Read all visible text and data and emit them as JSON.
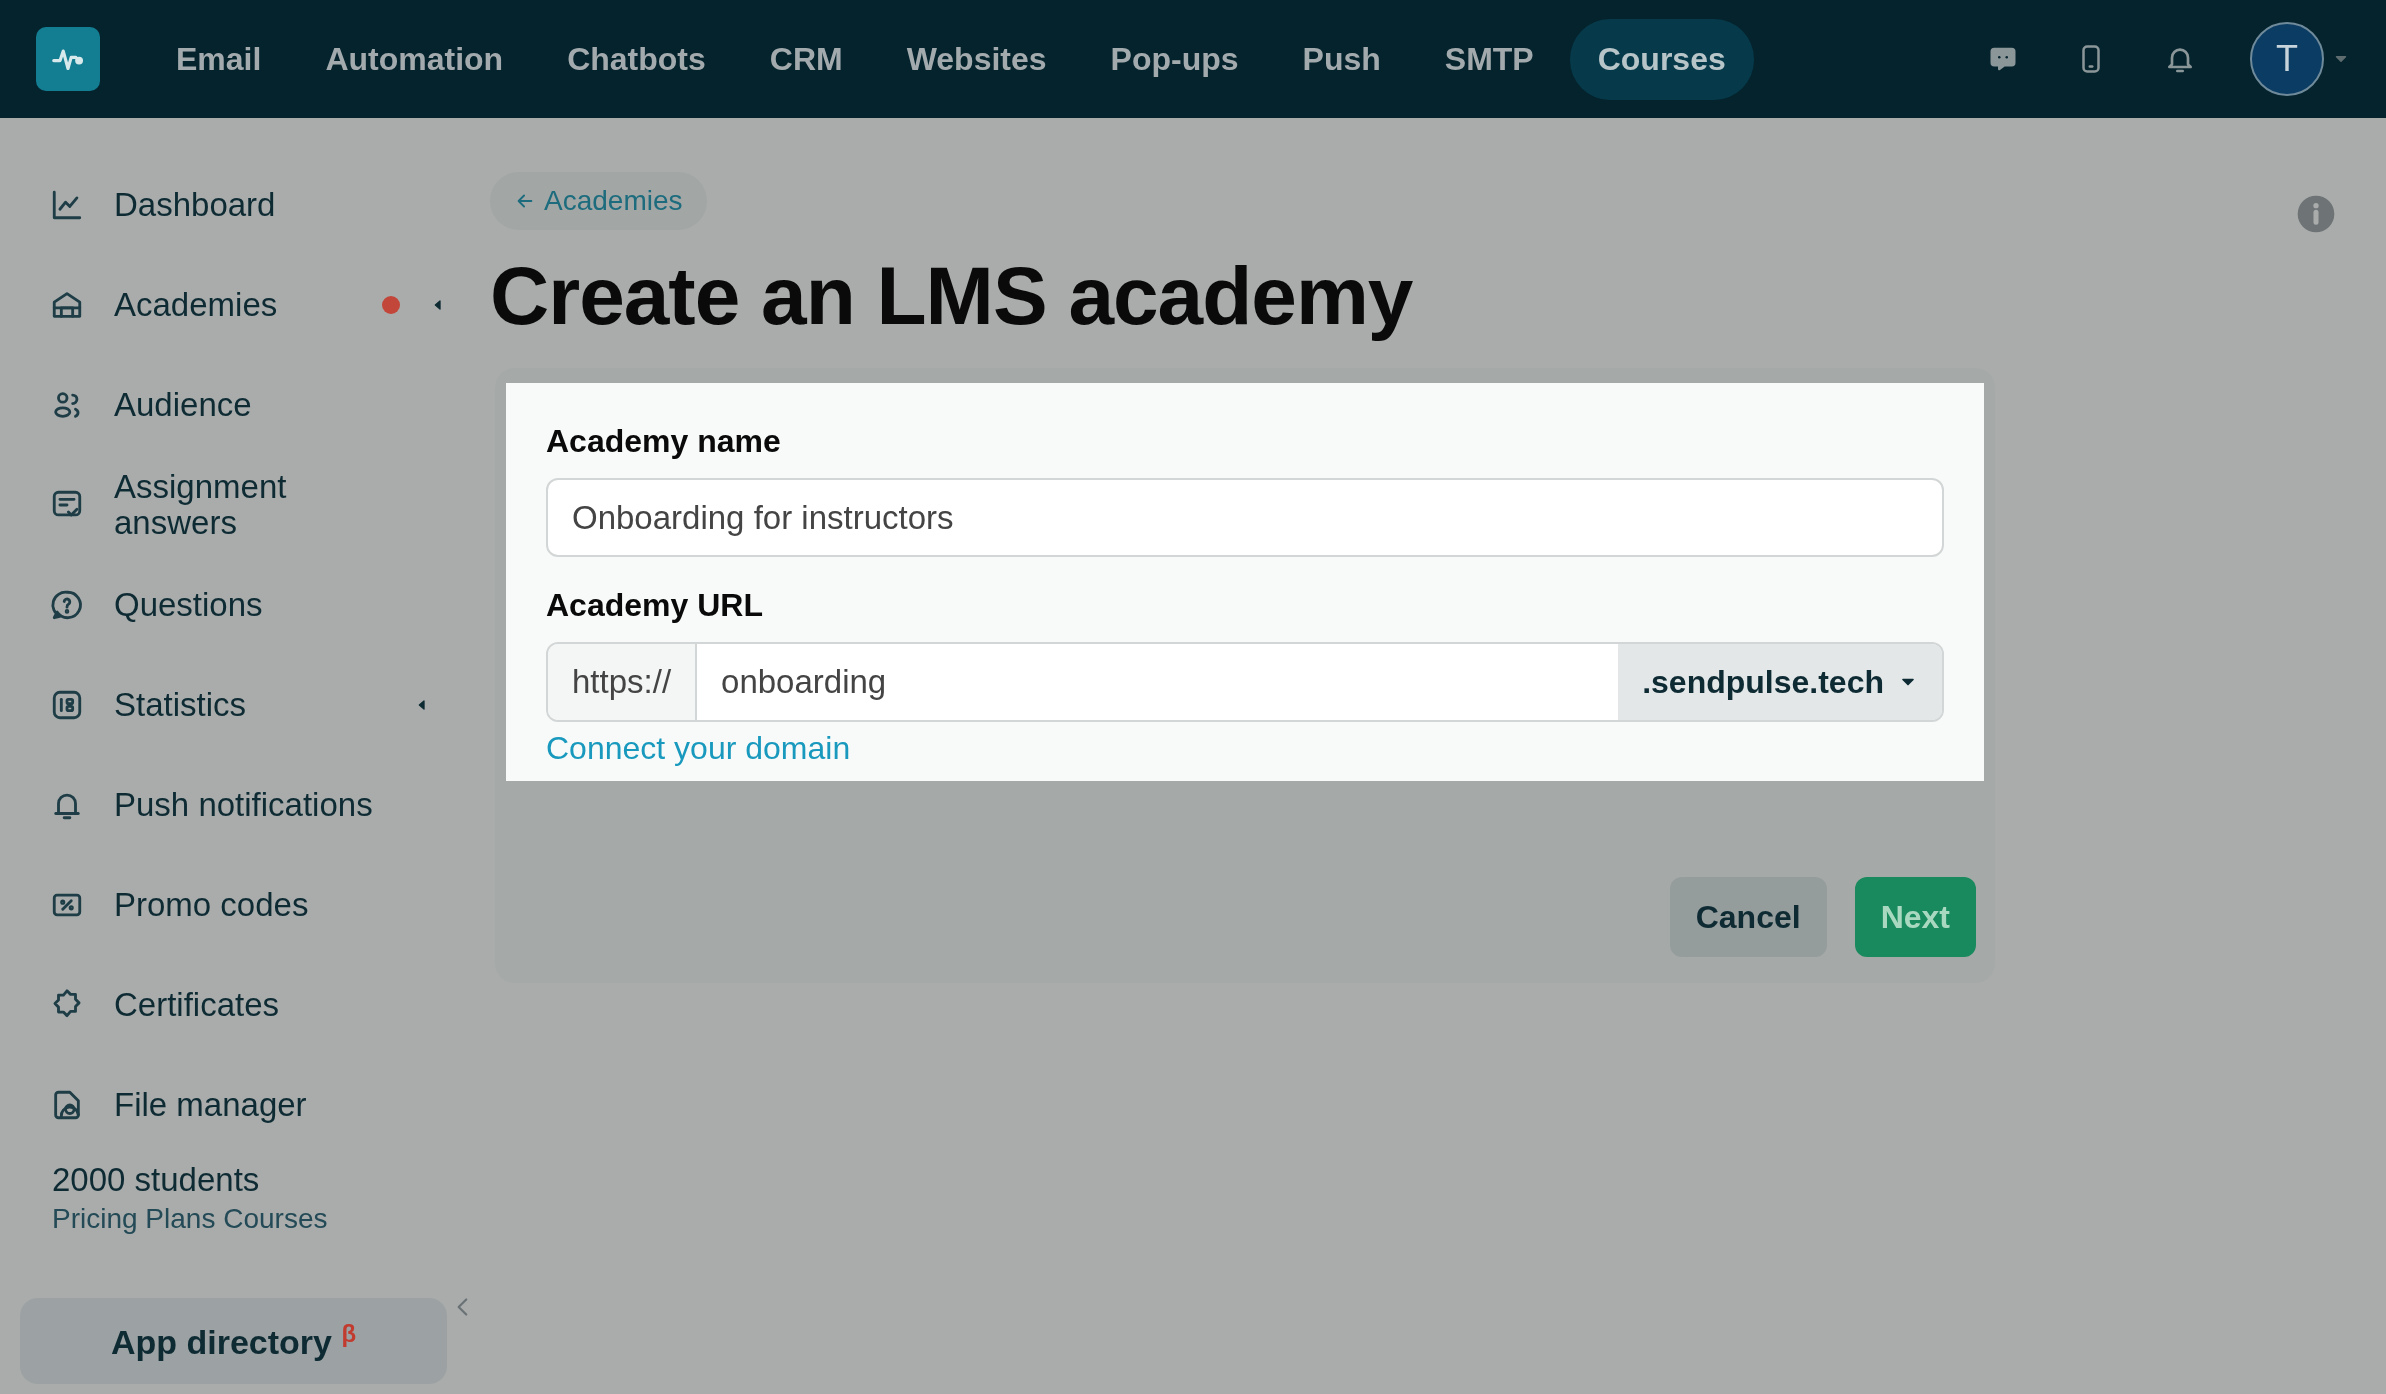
{
  "top_nav": {
    "items": [
      {
        "label": "Email",
        "selected": false
      },
      {
        "label": "Automation",
        "selected": false
      },
      {
        "label": "Chatbots",
        "selected": false
      },
      {
        "label": "CRM",
        "selected": false
      },
      {
        "label": "Websites",
        "selected": false
      },
      {
        "label": "Pop-ups",
        "selected": false
      },
      {
        "label": "Push",
        "selected": false
      },
      {
        "label": "SMTP",
        "selected": false
      },
      {
        "label": "Courses",
        "selected": true
      }
    ],
    "avatar": "T"
  },
  "sidebar": {
    "items": [
      {
        "label": "Dashboard",
        "alert": false,
        "submenu": false
      },
      {
        "label": "Academies",
        "alert": true,
        "submenu": true
      },
      {
        "label": "Audience",
        "alert": false,
        "submenu": false
      },
      {
        "label": "Assignment answers",
        "alert": false,
        "submenu": false
      },
      {
        "label": "Questions",
        "alert": false,
        "submenu": false
      },
      {
        "label": "Statistics",
        "alert": false,
        "submenu": true
      },
      {
        "label": "Push notifications",
        "alert": false,
        "submenu": false
      },
      {
        "label": "Promo codes",
        "alert": false,
        "submenu": false
      },
      {
        "label": "Certificates",
        "alert": false,
        "submenu": false
      },
      {
        "label": "File manager",
        "alert": false,
        "submenu": false
      }
    ],
    "plan": {
      "title": "2000 students",
      "link": "Pricing Plans Courses"
    },
    "app_directory": "App directory $^{β}$"
  },
  "main": {
    "back_link": "Academies",
    "title": "Create an LMS academy",
    "form": {
      "name_field": {
        "label": "Academy name",
        "value": "Onboarding for instructors"
      },
      "url_field": {
        "label": "Academy URL",
        "prefix": "https://",
        "value": "onboarding",
        "domain": ".sendpulse.tech"
      },
      "link": "Connect your domain"
    },
    "buttons": [
      {
        "label": "Cancel",
        "kind": "secondary"
      },
      {
        "label": "Next",
        "kind": "primary"
      }
    ]
  }
}
